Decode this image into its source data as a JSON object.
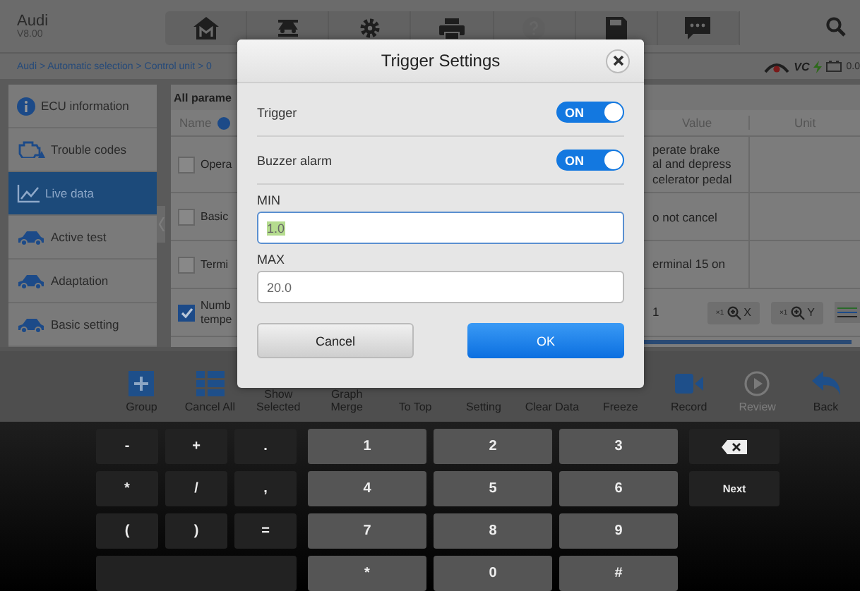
{
  "app": {
    "title": "Audi",
    "version": "V8.00"
  },
  "nav_bar": [
    {
      "kind": "home",
      "disabled": false
    },
    {
      "kind": "lift",
      "disabled": false
    },
    {
      "kind": "gear",
      "disabled": false
    },
    {
      "kind": "printer",
      "disabled": false
    },
    {
      "kind": "help",
      "disabled": true
    },
    {
      "kind": "save",
      "disabled": false
    },
    {
      "kind": "chat",
      "disabled": false
    }
  ],
  "breadcrumb": "Audi > Automatic selection > Control unit > 0",
  "status": {
    "vci_label": "VC",
    "battery_reading": "0.0"
  },
  "sidebar": [
    {
      "kind": "info",
      "label": "ECU information",
      "selected": false
    },
    {
      "kind": "engine",
      "label": "Trouble codes",
      "selected": false
    },
    {
      "kind": "chart",
      "label": "Live data",
      "selected": true
    },
    {
      "kind": "car",
      "label": "Active test",
      "selected": false
    },
    {
      "kind": "car",
      "label": "Adaptation",
      "selected": false
    },
    {
      "kind": "car",
      "label": "Basic setting",
      "selected": false
    }
  ],
  "table": {
    "title": "All parame",
    "columns": [
      "Name",
      "Value",
      "Unit"
    ],
    "rows": [
      {
        "checked": false,
        "name": "Opera",
        "value": [
          "perate brake",
          "al and depress",
          "celerator pedal"
        ]
      },
      {
        "checked": false,
        "name": "Basic",
        "value": [
          "o not cancel"
        ]
      },
      {
        "checked": false,
        "name": "Termi",
        "value": [
          "erminal 15 on"
        ]
      },
      {
        "checked": true,
        "name": "Numb tempe",
        "value": [
          "1"
        ],
        "zoom_buttons": [
          {
            "scale": "×1",
            "axis": "X"
          },
          {
            "scale": "×1",
            "axis": "Y"
          }
        ]
      }
    ]
  },
  "toolbar": [
    {
      "kind": "group",
      "label": "Group",
      "disabled": false
    },
    {
      "kind": "cancel_all",
      "label": "Cancel All",
      "disabled": false
    },
    {
      "kind": "hidden",
      "label": "Show Selected",
      "disabled": false
    },
    {
      "kind": "hidden",
      "label": "Graph Merge",
      "disabled": false
    },
    {
      "kind": "hidden",
      "label": "To Top",
      "disabled": false
    },
    {
      "kind": "hidden",
      "label": "Setting",
      "disabled": false
    },
    {
      "kind": "hidden",
      "label": "Clear Data",
      "disabled": false
    },
    {
      "kind": "hidden",
      "label": "Freeze",
      "disabled": false
    },
    {
      "kind": "record",
      "label": "Record",
      "disabled": false
    },
    {
      "kind": "review",
      "label": "Review",
      "disabled": true
    },
    {
      "kind": "back",
      "label": "Back",
      "disabled": false
    }
  ],
  "dialog": {
    "title": "Trigger Settings",
    "toggles": [
      {
        "label": "Trigger",
        "on": true,
        "state_text": "ON"
      },
      {
        "label": "Buzzer alarm",
        "on": true,
        "state_text": "ON"
      }
    ],
    "fields": [
      {
        "label": "MIN",
        "value": "1.0",
        "focused": true
      },
      {
        "label": "MAX",
        "value": "20.0",
        "focused": false
      }
    ],
    "buttons": [
      {
        "kind": "secondary",
        "label": "Cancel"
      },
      {
        "kind": "primary",
        "label": "OK"
      }
    ]
  },
  "keyboard": {
    "symbols": [
      {
        "kind": "char",
        "label": "-"
      },
      {
        "kind": "char",
        "label": "+"
      },
      {
        "kind": "char",
        "label": "."
      },
      {
        "kind": "char",
        "label": "*"
      },
      {
        "kind": "char",
        "label": "/"
      },
      {
        "kind": "char",
        "label": ","
      },
      {
        "kind": "char",
        "label": "("
      },
      {
        "kind": "char",
        "label": ")"
      },
      {
        "kind": "char",
        "label": "="
      },
      {
        "kind": "space"
      }
    ],
    "digits": [
      "1",
      "2",
      "3",
      "4",
      "5",
      "6",
      "7",
      "8",
      "9",
      "*",
      "0",
      "#"
    ],
    "actions": [
      {
        "kind": "backspace"
      },
      {
        "kind": "action",
        "label": "Next"
      }
    ]
  }
}
